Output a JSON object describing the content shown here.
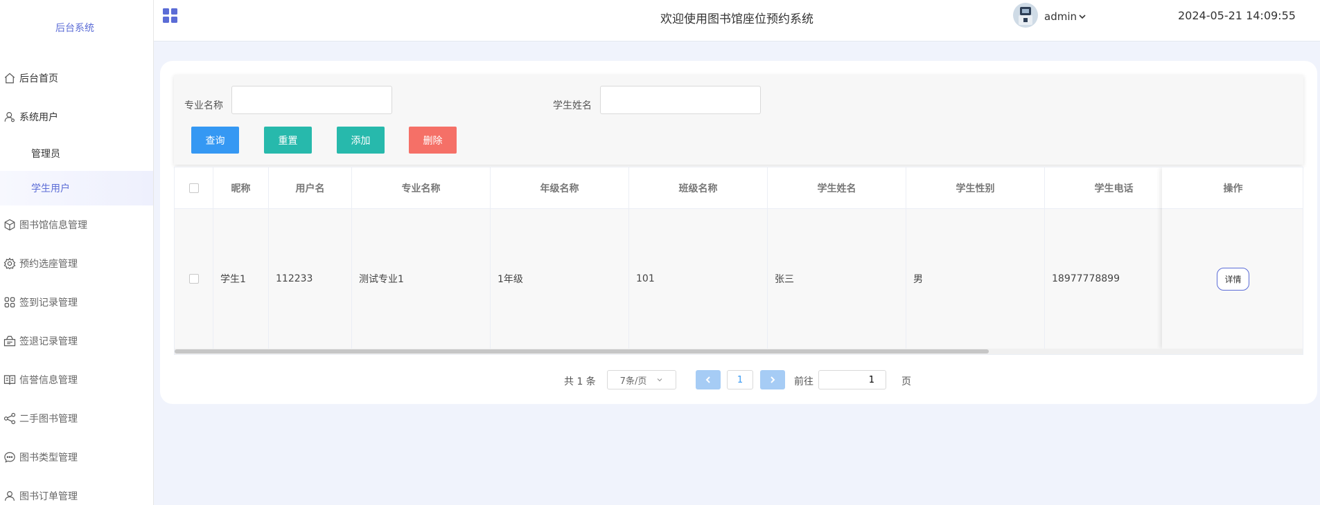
{
  "sidebar": {
    "brand": "后台系统",
    "items": [
      {
        "label": "后台首页",
        "icon": "home-icon"
      },
      {
        "label": "系统用户",
        "icon": "user-icon"
      },
      {
        "label": "管理员"
      },
      {
        "label": "学生用户",
        "active": true
      },
      {
        "label": "图书馆信息管理",
        "icon": "cube-icon"
      },
      {
        "label": "预约选座管理",
        "icon": "gear-icon"
      },
      {
        "label": "签到记录管理",
        "icon": "apps-icon"
      },
      {
        "label": "签退记录管理",
        "icon": "inbox-icon"
      },
      {
        "label": "信誉信息管理",
        "icon": "book-icon"
      },
      {
        "label": "二手图书管理",
        "icon": "share-icon"
      },
      {
        "label": "图书类型管理",
        "icon": "chat-icon"
      },
      {
        "label": "图书订单管理",
        "icon": "person-icon"
      }
    ]
  },
  "header": {
    "title": "欢迎使用图书馆座位预约系统",
    "username": "admin",
    "datetime": "2024-05-21 14:09:55"
  },
  "filter": {
    "major_label": "专业名称",
    "major_value": "",
    "student_label": "学生姓名",
    "student_value": "",
    "buttons": {
      "query": "查询",
      "reset": "重置",
      "add": "添加",
      "delete": "删除"
    }
  },
  "table": {
    "columns": [
      "昵称",
      "用户名",
      "专业名称",
      "年级名称",
      "班级名称",
      "学生姓名",
      "学生性别",
      "学生电话"
    ],
    "ops_header": "操作",
    "rows": [
      {
        "cells": [
          "学生1",
          "112233",
          "测试专业1",
          "1年级",
          "101",
          "张三",
          "男",
          "18977778899"
        ],
        "action": "详情"
      }
    ]
  },
  "pagination": {
    "total": "共 1 条",
    "page_size": "7条/页",
    "current_page": "1",
    "goto_label": "前往",
    "goto_value": "1",
    "page_suffix": "页"
  },
  "colors": {
    "accent": "#5b6cd6",
    "query": "#3598f3",
    "reset": "#27b9ac",
    "add": "#27b9ac",
    "delete": "#f57067",
    "pager_arrow": "#a6ccf5"
  }
}
